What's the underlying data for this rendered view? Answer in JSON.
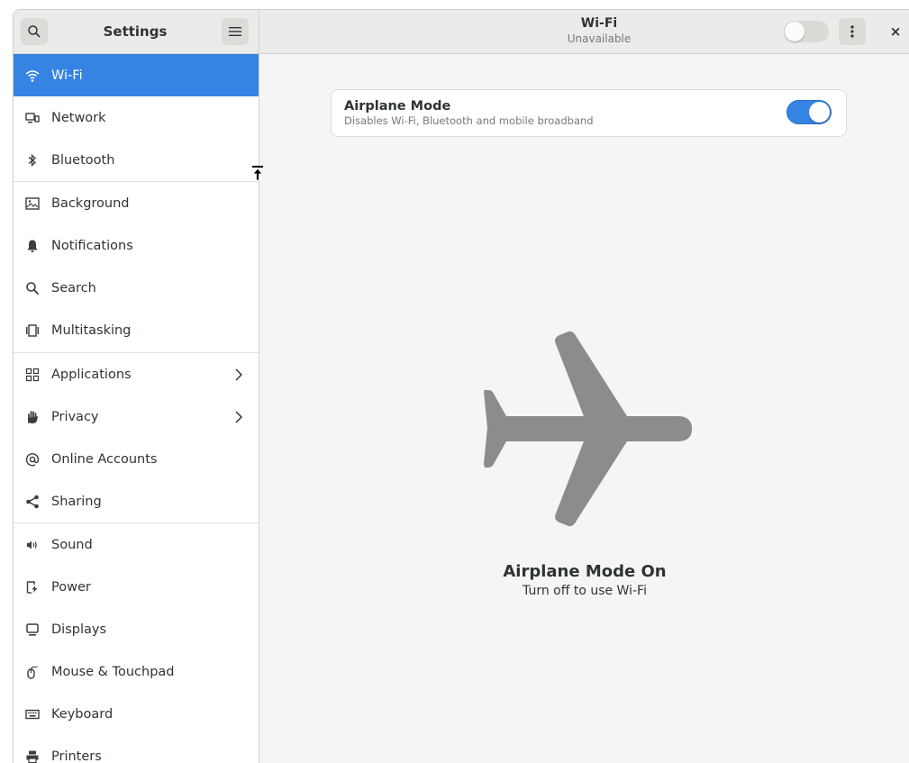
{
  "header": {
    "app_title": "Settings",
    "page_title": "Wi-Fi",
    "page_subtitle": "Unavailable",
    "wifi_switch_on": false,
    "close_label": "×"
  },
  "sidebar": {
    "items": [
      {
        "label": "Wi-Fi",
        "icon": "wifi-icon",
        "active": true
      },
      {
        "label": "Network",
        "icon": "network-icon"
      },
      {
        "label": "Bluetooth",
        "icon": "bluetooth-icon"
      },
      {
        "label": "Background",
        "icon": "background-icon"
      },
      {
        "label": "Notifications",
        "icon": "bell-icon"
      },
      {
        "label": "Search",
        "icon": "search-icon"
      },
      {
        "label": "Multitasking",
        "icon": "multitasking-icon"
      },
      {
        "label": "Applications",
        "icon": "applications-icon",
        "chevron": true
      },
      {
        "label": "Privacy",
        "icon": "hand-icon",
        "chevron": true
      },
      {
        "label": "Online Accounts",
        "icon": "at-icon"
      },
      {
        "label": "Sharing",
        "icon": "share-icon"
      },
      {
        "label": "Sound",
        "icon": "speaker-icon"
      },
      {
        "label": "Power",
        "icon": "power-icon"
      },
      {
        "label": "Displays",
        "icon": "display-icon"
      },
      {
        "label": "Mouse & Touchpad",
        "icon": "mouse-icon"
      },
      {
        "label": "Keyboard",
        "icon": "keyboard-icon"
      },
      {
        "label": "Printers",
        "icon": "printer-icon"
      }
    ]
  },
  "airplane_mode": {
    "title": "Airplane Mode",
    "description": "Disables Wi-Fi, Bluetooth and mobile broadband",
    "enabled": true
  },
  "status": {
    "title": "Airplane Mode On",
    "subtitle": "Turn off to use Wi-Fi"
  },
  "colors": {
    "accent": "#3584e4",
    "sidebar_bg": "#ffffff",
    "content_bg": "#f6f5f4",
    "header_bg": "#ebebea",
    "plane_icon": "#8b8c8b"
  }
}
